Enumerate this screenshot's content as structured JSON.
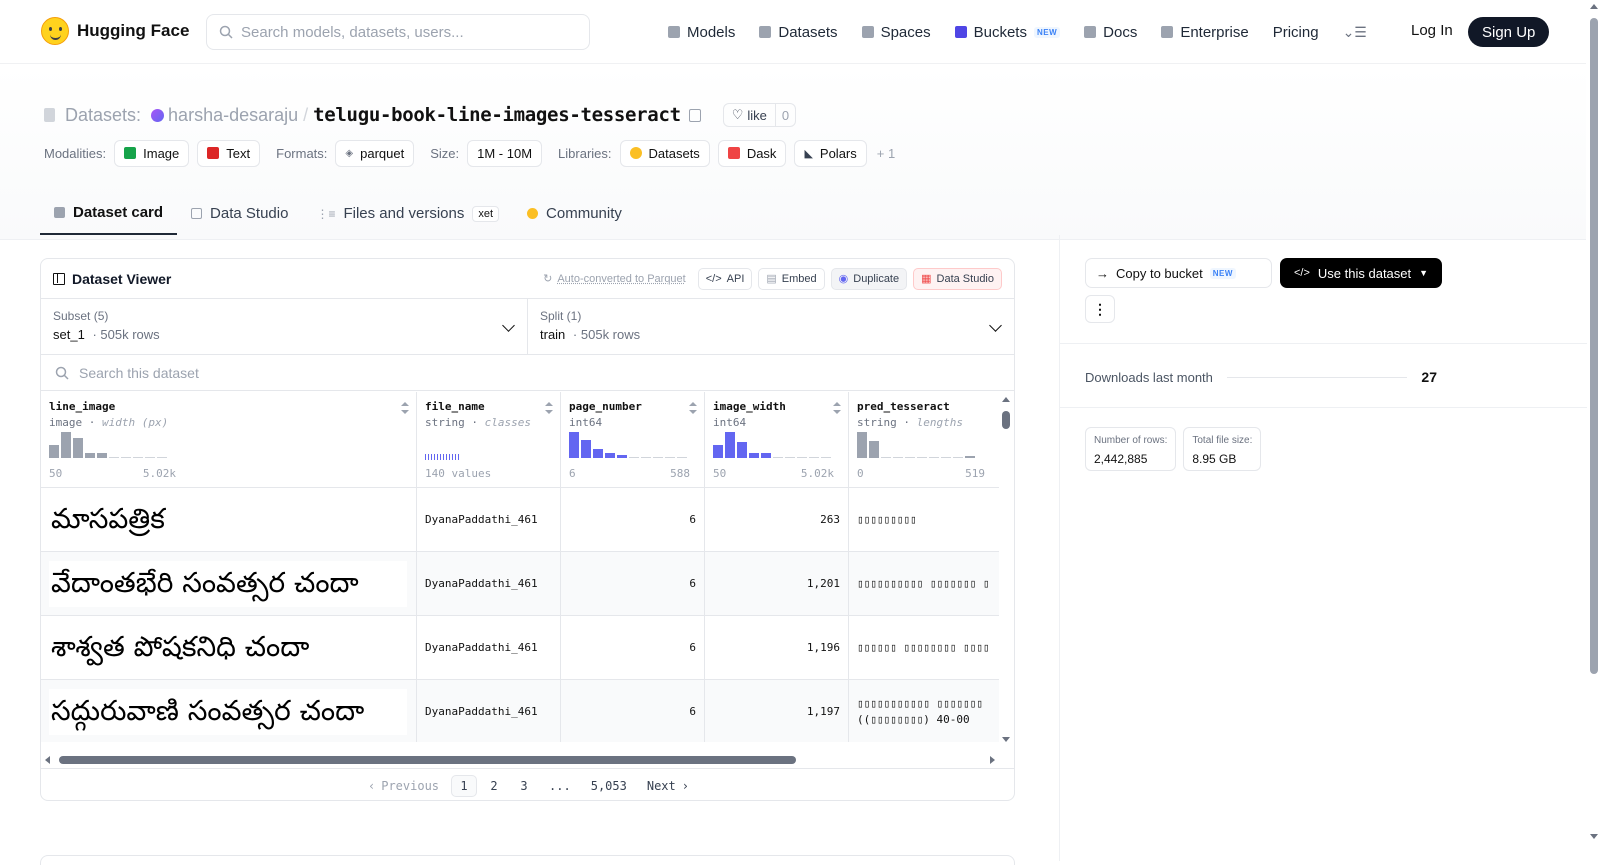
{
  "nav": {
    "brand": "Hugging Face",
    "search_placeholder": "Search models, datasets, users...",
    "links": [
      {
        "label": "Models",
        "icon": "cube-icon",
        "color": "#9ca3af"
      },
      {
        "label": "Datasets",
        "icon": "database-icon",
        "color": "#9ca3af"
      },
      {
        "label": "Spaces",
        "icon": "grid-icon",
        "color": "#9ca3af"
      },
      {
        "label": "Buckets",
        "icon": "bucket-icon",
        "color": "#4f46e5",
        "badge": "NEW"
      },
      {
        "label": "Docs",
        "icon": "book-icon",
        "color": "#9ca3af"
      },
      {
        "label": "Enterprise",
        "icon": "building-icon",
        "color": "#9ca3af"
      },
      {
        "label": "Pricing"
      }
    ],
    "login": "Log In",
    "signup": "Sign Up"
  },
  "repo": {
    "type_label": "Datasets:",
    "user": "harsha-desaraju",
    "separator": "/",
    "name": "telugu-book-line-images-tesseract",
    "like_label": "like",
    "like_count": "0"
  },
  "tags": {
    "modalities_label": "Modalities:",
    "modalities": [
      {
        "label": "Image",
        "color": "#16a34a"
      },
      {
        "label": "Text",
        "color": "#dc2626"
      }
    ],
    "formats_label": "Formats:",
    "formats": [
      {
        "label": "parquet",
        "color": "#6b7280"
      }
    ],
    "size_label": "Size:",
    "size": "1M - 10M",
    "libraries_label": "Libraries:",
    "libraries": [
      {
        "label": "Datasets",
        "color": "#fbbf24"
      },
      {
        "label": "Dask",
        "color": "#ef4444"
      },
      {
        "label": "Polars",
        "color": "#374151"
      }
    ],
    "more": "+ 1"
  },
  "tabs": [
    {
      "label": "Dataset card",
      "active": true
    },
    {
      "label": "Data Studio"
    },
    {
      "label": "Files and versions",
      "badge": "xet"
    },
    {
      "label": "Community"
    }
  ],
  "viewer": {
    "title": "Dataset Viewer",
    "auto_converted": "Auto-converted to Parquet",
    "actions": [
      "API",
      "Embed",
      "Duplicate",
      "Data Studio"
    ],
    "subset_label": "Subset (5)",
    "subset_value": "set_1",
    "subset_rows": "505k rows",
    "split_label": "Split (1)",
    "split_value": "train",
    "split_rows": "505k rows",
    "search_placeholder": "Search this dataset",
    "columns": [
      {
        "name": "line_image",
        "type": "image",
        "meta": "width (px)",
        "hist": [
          0.5,
          1.0,
          0.75,
          0.2,
          0.2,
          0,
          0,
          0,
          0,
          0
        ],
        "range": [
          "50",
          "5.02k"
        ],
        "color": "gray"
      },
      {
        "name": "file_name",
        "type": "string",
        "meta": "classes",
        "values_note": "140 values"
      },
      {
        "name": "page_number",
        "type": "int64",
        "meta": "",
        "hist": [
          1.0,
          0.7,
          0.35,
          0.2,
          0.1,
          0,
          0,
          0,
          0,
          0
        ],
        "range": [
          "6",
          "588"
        ],
        "color": "blue"
      },
      {
        "name": "image_width",
        "type": "int64",
        "meta": "",
        "hist": [
          0.5,
          1.0,
          0.6,
          0.2,
          0.2,
          0,
          0,
          0,
          0,
          0
        ],
        "range": [
          "50",
          "5.02k"
        ],
        "color": "blue"
      },
      {
        "name": "pred_tesseract",
        "type": "string",
        "meta": "lengths",
        "hist": [
          1.0,
          0.65,
          0,
          0,
          0,
          0,
          0,
          0,
          0,
          0.08
        ],
        "range": [
          "0",
          "519"
        ],
        "color": "gray"
      }
    ],
    "rows": [
      {
        "image_text": "మాసపత్రిక",
        "file_name": "DyanaPaddathi_461",
        "page_number": "6",
        "image_width": "263",
        "pred": "▯▯▯▯▯▯▯▯▯"
      },
      {
        "image_text": "వేదాంతభేరి సంవత్సర చందా",
        "file_name": "DyanaPaddathi_461",
        "page_number": "6",
        "image_width": "1,201",
        "pred": "▯▯▯▯▯▯▯▯▯▯ ▯▯▯▯▯▯▯ ▯"
      },
      {
        "image_text": "శాశ్వత పోషకనిధి చందా",
        "file_name": "DyanaPaddathi_461",
        "page_number": "6",
        "image_width": "1,196",
        "pred": "▯▯▯▯▯▯ ▯▯▯▯▯▯▯▯ ▯▯▯▯"
      },
      {
        "image_text": "సద్గురువాణి సంవత్సర చందా",
        "file_name": "DyanaPaddathi_461",
        "page_number": "6",
        "image_width": "1,197",
        "pred": "▯▯▯▯▯▯▯▯▯▯▯ ▯▯▯▯▯▯▯ ((▯▯▯▯▯▯▯▯) 40-00"
      }
    ],
    "pagination": {
      "previous": "Previous",
      "pages": [
        "1",
        "2",
        "3",
        "...",
        "5,053"
      ],
      "next": "Next",
      "current": "1"
    }
  },
  "sidebar": {
    "copy_bucket": "Copy to bucket",
    "copy_badge": "NEW",
    "use_dataset": "Use this dataset",
    "downloads_label": "Downloads last month",
    "downloads_value": "27",
    "stats": [
      {
        "label": "Number of rows:",
        "value": "2,442,885"
      },
      {
        "label": "Total file size:",
        "value": "8.95 GB"
      }
    ]
  }
}
